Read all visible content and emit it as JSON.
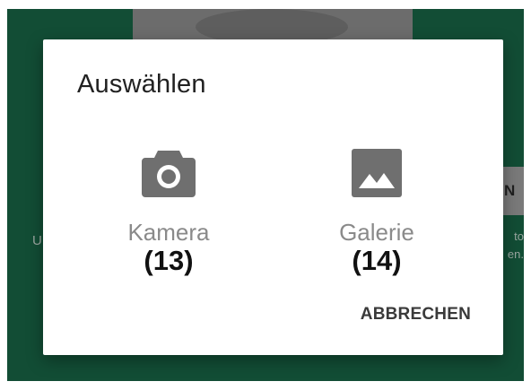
{
  "dialog": {
    "title": "Auswählen",
    "options": [
      {
        "label": "Kamera",
        "number": "(13)",
        "icon": "camera-icon"
      },
      {
        "label": "Galerie",
        "number": "(14)",
        "icon": "image-icon"
      }
    ],
    "cancel_label": "ABBRECHEN"
  },
  "background": {
    "button_text": "N",
    "left_text": "U",
    "right_text_lines": [
      "to",
      "en."
    ]
  },
  "colors": {
    "backdrop": "#124d35",
    "icon": "#6f6f6f",
    "label": "#8a8a8a",
    "number": "#111111"
  }
}
